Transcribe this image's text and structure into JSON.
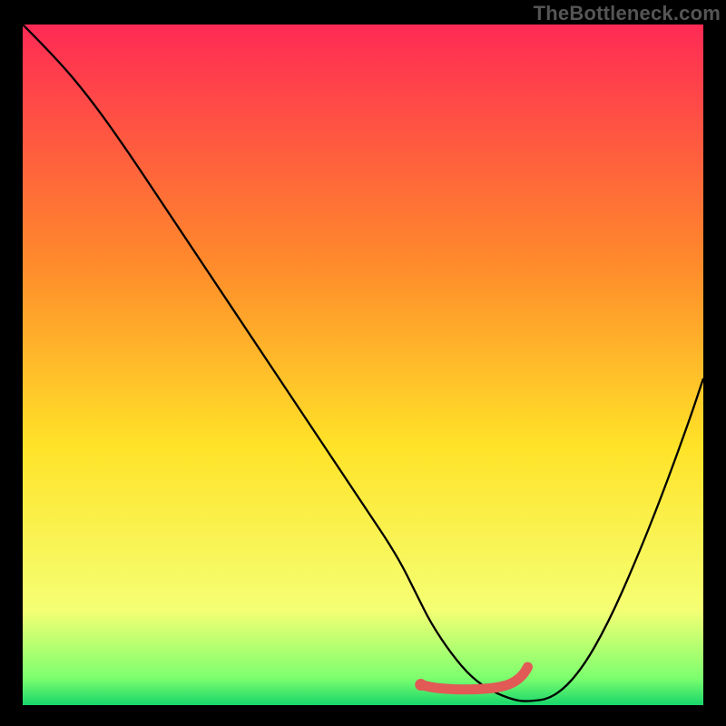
{
  "watermark": "TheBottleneck.com",
  "colors": {
    "frame": "#000000",
    "gradient_top": "#ff2a55",
    "gradient_mid1": "#ff8a2b",
    "gradient_mid2": "#ffe328",
    "gradient_bot1": "#f5ff74",
    "gradient_bot2": "#7dff6e",
    "gradient_bot3": "#18d66b",
    "curve": "#000000",
    "marker": "#e15a56"
  },
  "chart_data": {
    "type": "line",
    "title": "",
    "xlabel": "",
    "ylabel": "",
    "xlim": [
      0,
      100
    ],
    "ylim": [
      0,
      100
    ],
    "series": [
      {
        "name": "bottleneck-curve",
        "x": [
          0,
          5,
          10,
          15,
          20,
          25,
          30,
          35,
          40,
          45,
          50,
          55,
          58,
          60,
          63,
          66,
          69,
          72,
          74,
          78,
          82,
          86,
          90,
          94,
          98,
          100
        ],
        "y": [
          100,
          95,
          89,
          82,
          74.5,
          67,
          59.5,
          52,
          44.5,
          37,
          29.5,
          22,
          16,
          12,
          7.5,
          4,
          2,
          0.8,
          0.5,
          1,
          5,
          12,
          21,
          31,
          42,
          48
        ]
      },
      {
        "name": "optimal-region-marker",
        "x": [
          58.5,
          60,
          62,
          64,
          66,
          68,
          70,
          72,
          73.5,
          74.2
        ],
        "y": [
          3.0,
          2.6,
          2.4,
          2.3,
          2.3,
          2.4,
          2.6,
          3.2,
          4.4,
          5.6
        ]
      }
    ],
    "annotations": []
  }
}
